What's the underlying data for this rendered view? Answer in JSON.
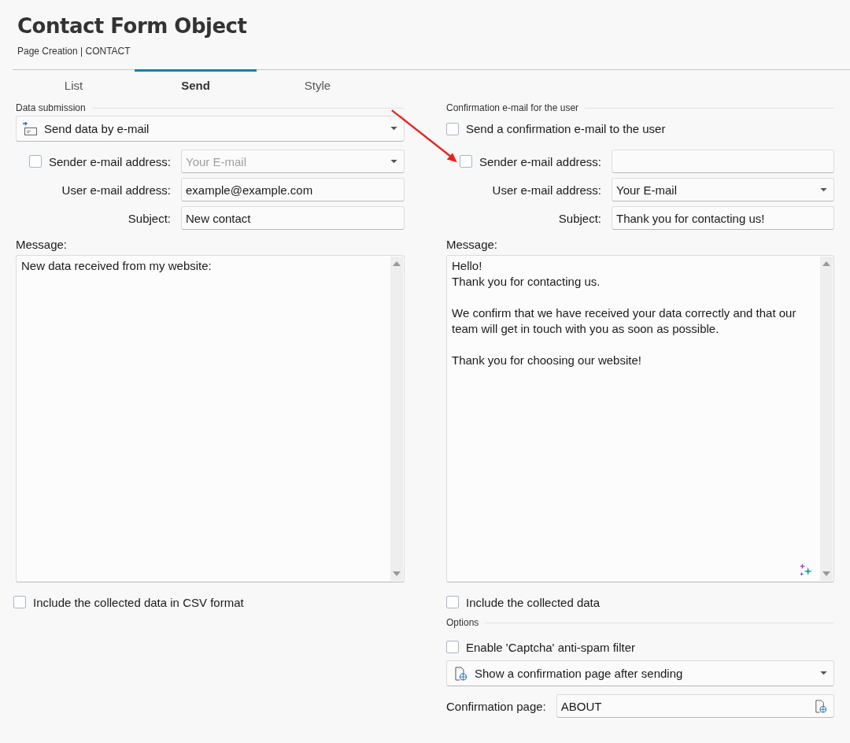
{
  "header": {
    "title": "Contact Form Object",
    "breadcrumb": "Page Creation | CONTACT"
  },
  "tabs": [
    {
      "label": "List",
      "selected": false
    },
    {
      "label": "Send",
      "selected": true
    },
    {
      "label": "Style",
      "selected": false
    }
  ],
  "left": {
    "section": "Data submission",
    "method": {
      "value": "Send data by e-mail"
    },
    "fields": [
      {
        "label": "Sender e-mail address:",
        "kind": "dropdown",
        "checked": false,
        "placeholder": "Your E-mail"
      },
      {
        "label": "User e-mail address:",
        "kind": "text",
        "value": "example@example.com"
      },
      {
        "label": "Subject:",
        "kind": "text",
        "value": "New contact"
      }
    ],
    "message_label": "Message:",
    "message": "New data received from my website:",
    "ai_icon": false,
    "include": {
      "label": "Include the collected data in CSV format",
      "checked": false
    }
  },
  "right": {
    "section": "Confirmation e-mail for the user",
    "send_confirmation": {
      "label": "Send a confirmation e-mail to the user",
      "checked": false
    },
    "fields": [
      {
        "label": "Sender e-mail address:",
        "kind": "text",
        "checked": false
      },
      {
        "label": "User e-mail address:",
        "kind": "dropdown",
        "value": "Your E-mail"
      },
      {
        "label": "Subject:",
        "kind": "text",
        "value": "Thank you for contacting us!"
      }
    ],
    "message_label": "Message:",
    "message": "Hello!\nThank you for contacting us.\n\nWe confirm that we have received your data correctly and that our team will get in touch with you as soon as possible.\n\nThank you for choosing our website!",
    "ai_icon": true,
    "include": {
      "label": "Include the collected data",
      "checked": false
    }
  },
  "options": {
    "section": "Options",
    "captcha": {
      "label": "Enable 'Captcha' anti-spam filter",
      "checked": false
    },
    "after_send": {
      "value": "Show a confirmation page after sending"
    },
    "confirmation_page": {
      "label": "Confirmation page:",
      "value": "ABOUT"
    }
  }
}
